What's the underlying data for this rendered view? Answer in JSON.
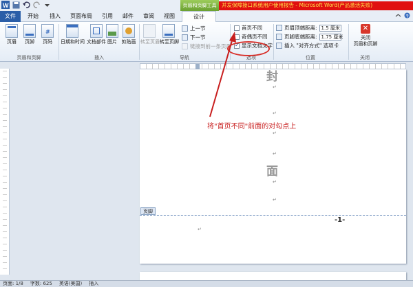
{
  "titlebar": {
    "context_group": "页眉和页脚工具",
    "document_title": "并发保障接口系统用户使用报告 - Microsoft Word(产品激活失败)"
  },
  "tabs": [
    "文件",
    "开始",
    "插入",
    "页面布局",
    "引用",
    "邮件",
    "审阅",
    "视图",
    "设计"
  ],
  "ribbon": {
    "groups": {
      "header_footer": "页眉和页脚",
      "insert": "插入",
      "navigation": "导航",
      "options": "选项",
      "position": "位置",
      "close": "关闭"
    },
    "buttons": {
      "header": "页眉",
      "footer": "页脚",
      "page_number": "页码",
      "date_time": "日期和时间",
      "doc_parts": "文档部件",
      "picture": "图片",
      "clip_art": "剪贴画",
      "goto_header": "转至页眉",
      "goto_footer": "转至页脚",
      "prev_section": "上一节",
      "next_section": "下一节",
      "link_previous": "链接到前一条页眉",
      "close_hf_line1": "关闭",
      "close_hf_line2": "页眉和页脚"
    },
    "options": {
      "first_page_different": "首页不同",
      "odd_even_different": "奇偶页不同",
      "show_doc_text": "显示文档文字",
      "first_page_checked": false,
      "odd_even_checked": false,
      "show_doc_text_checked": true
    },
    "position": {
      "header_top_label": "页眉顶端距离:",
      "header_top_value": "1.5 厘米",
      "footer_bottom_label": "页脚底端距离:",
      "footer_bottom_value": "1.75 厘米",
      "insert_align_tab": "插入 \"对齐方式\" 选项卡"
    }
  },
  "document": {
    "char_top": "封",
    "char_mid": "面",
    "paragraph_mark": "↵",
    "footer_label": "页脚",
    "page_number": "-1-",
    "annotation": "将\"首页不同\"前面的对勾点上"
  },
  "statusbar": {
    "page": "页面: 1/8",
    "words": "字数: 625",
    "language": "英语(美国)",
    "mode": "插入"
  },
  "colors": {
    "accent_red": "#d8302a",
    "file_tab": "#2b5ea8",
    "context_green": "#7ab53c"
  }
}
